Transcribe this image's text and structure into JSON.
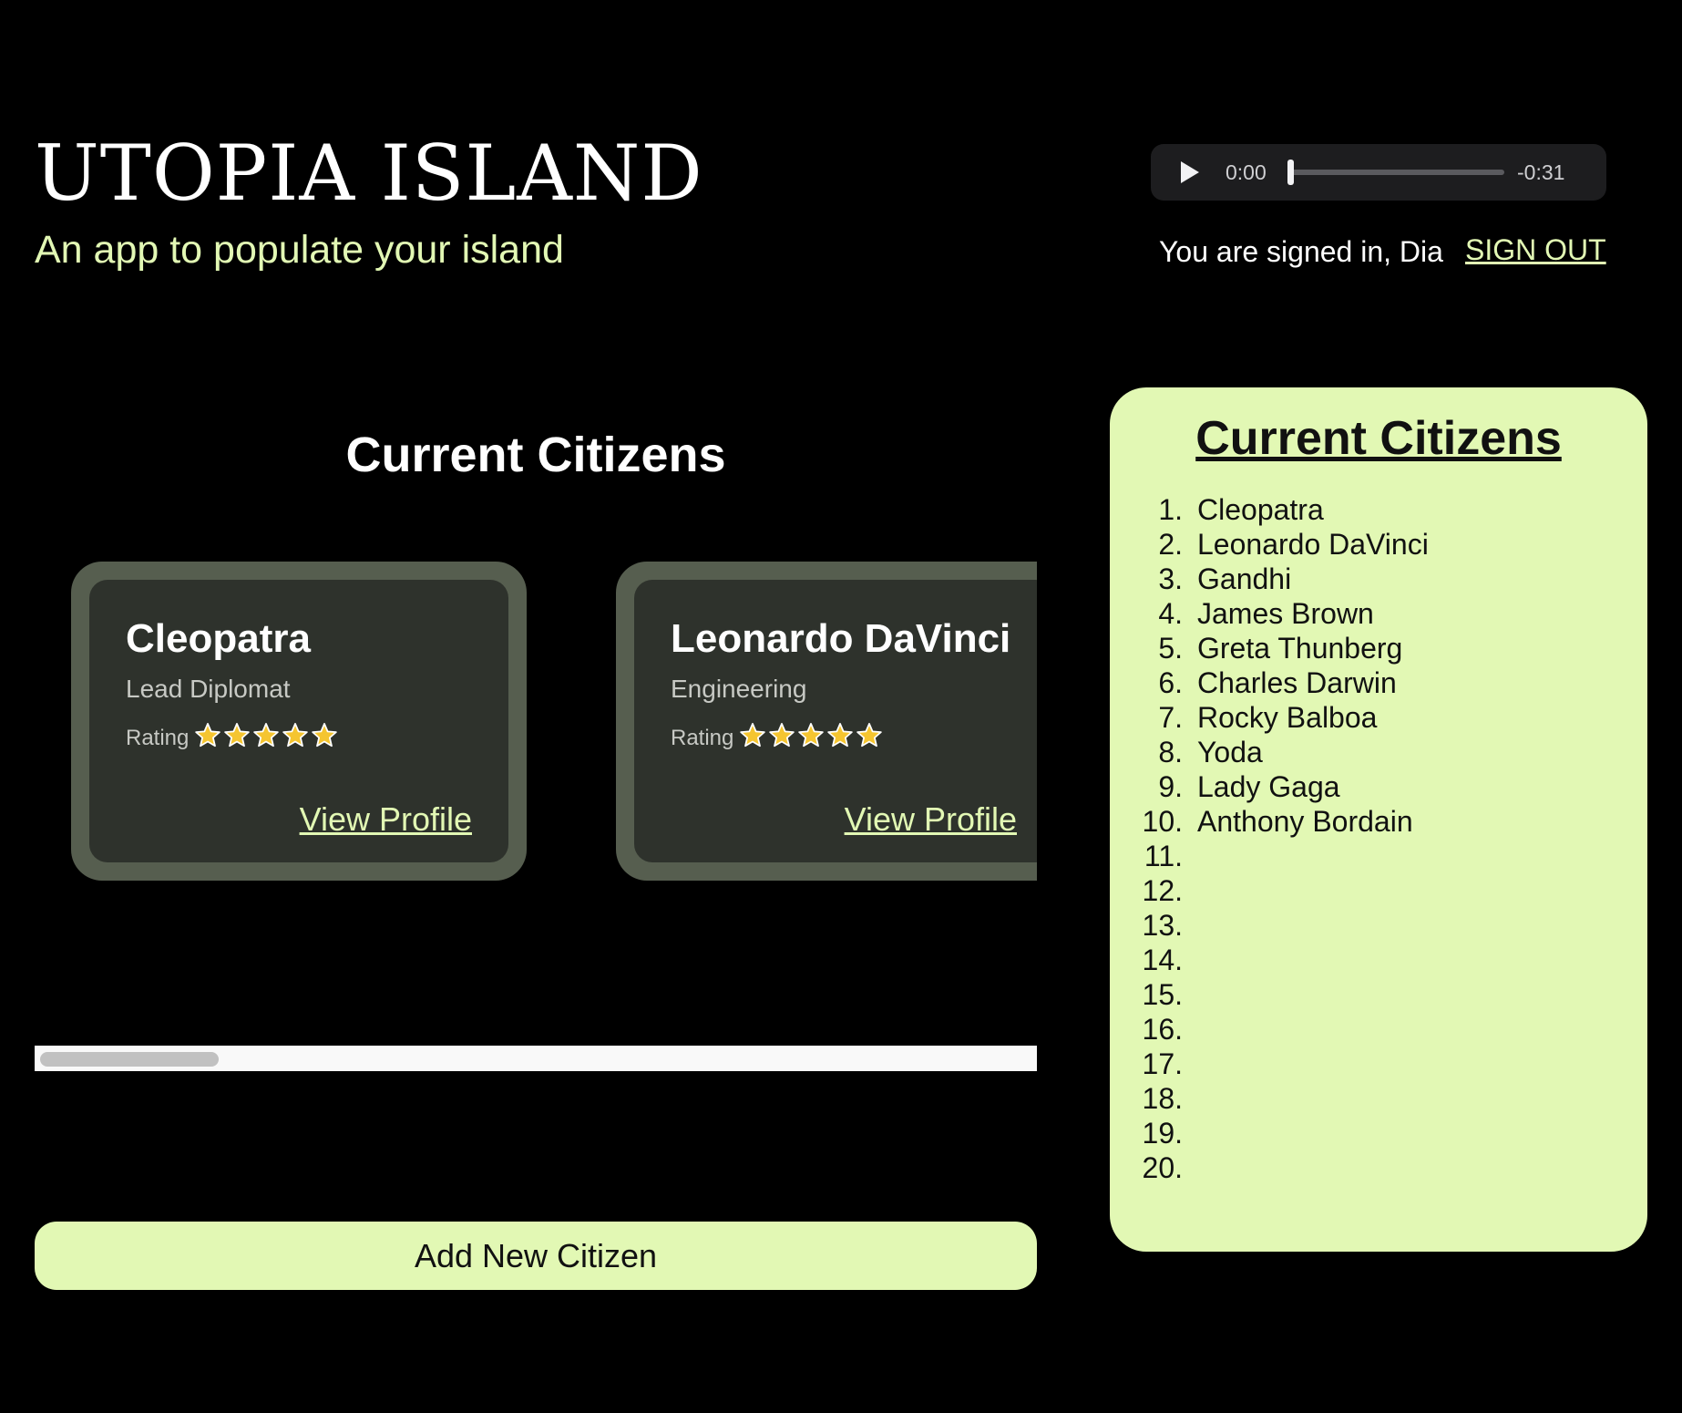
{
  "header": {
    "title": "UTOPIA ISLAND",
    "subtitle": "An app to populate your island"
  },
  "audio": {
    "current_time": "0:00",
    "remaining_time": "-0:31",
    "progress": 0
  },
  "session": {
    "signed_in_text": "You are signed in, Dia",
    "sign_out_label": "SIGN OUT"
  },
  "main": {
    "title": "Current Citizens",
    "cards": [
      {
        "name": "Cleopatra",
        "role": "Lead Diplomat",
        "rating_label": "Rating",
        "stars": 5,
        "link_label": "View Profile"
      },
      {
        "name": "Leonardo DaVinci",
        "role": "Engineering",
        "rating_label": "Rating",
        "stars": 5,
        "link_label": "View Profile"
      }
    ],
    "add_button_label": "Add New Citizen"
  },
  "panel": {
    "title": "Current Citizens",
    "items": [
      {
        "num": "1.",
        "name": "Cleopatra"
      },
      {
        "num": "2.",
        "name": "Leonardo DaVinci"
      },
      {
        "num": "3.",
        "name": "Gandhi"
      },
      {
        "num": "4.",
        "name": "James Brown"
      },
      {
        "num": "5.",
        "name": "Greta Thunberg"
      },
      {
        "num": "6.",
        "name": "Charles Darwin"
      },
      {
        "num": "7.",
        "name": "Rocky Balboa"
      },
      {
        "num": "8.",
        "name": "Yoda"
      },
      {
        "num": "9.",
        "name": "Lady Gaga"
      },
      {
        "num": "10.",
        "name": "Anthony Bordain"
      },
      {
        "num": "11.",
        "name": ""
      },
      {
        "num": "12.",
        "name": ""
      },
      {
        "num": "13.",
        "name": ""
      },
      {
        "num": "14.",
        "name": ""
      },
      {
        "num": "15.",
        "name": ""
      },
      {
        "num": "16.",
        "name": ""
      },
      {
        "num": "17.",
        "name": ""
      },
      {
        "num": "18.",
        "name": ""
      },
      {
        "num": "19.",
        "name": ""
      },
      {
        "num": "20.",
        "name": ""
      }
    ]
  },
  "colors": {
    "accent": "#e2f8b4",
    "card_outer": "#565e4f",
    "card_inner": "#2e322c",
    "star": "#f5c530"
  },
  "icons": {
    "play": "play-icon",
    "star": "star-icon"
  }
}
